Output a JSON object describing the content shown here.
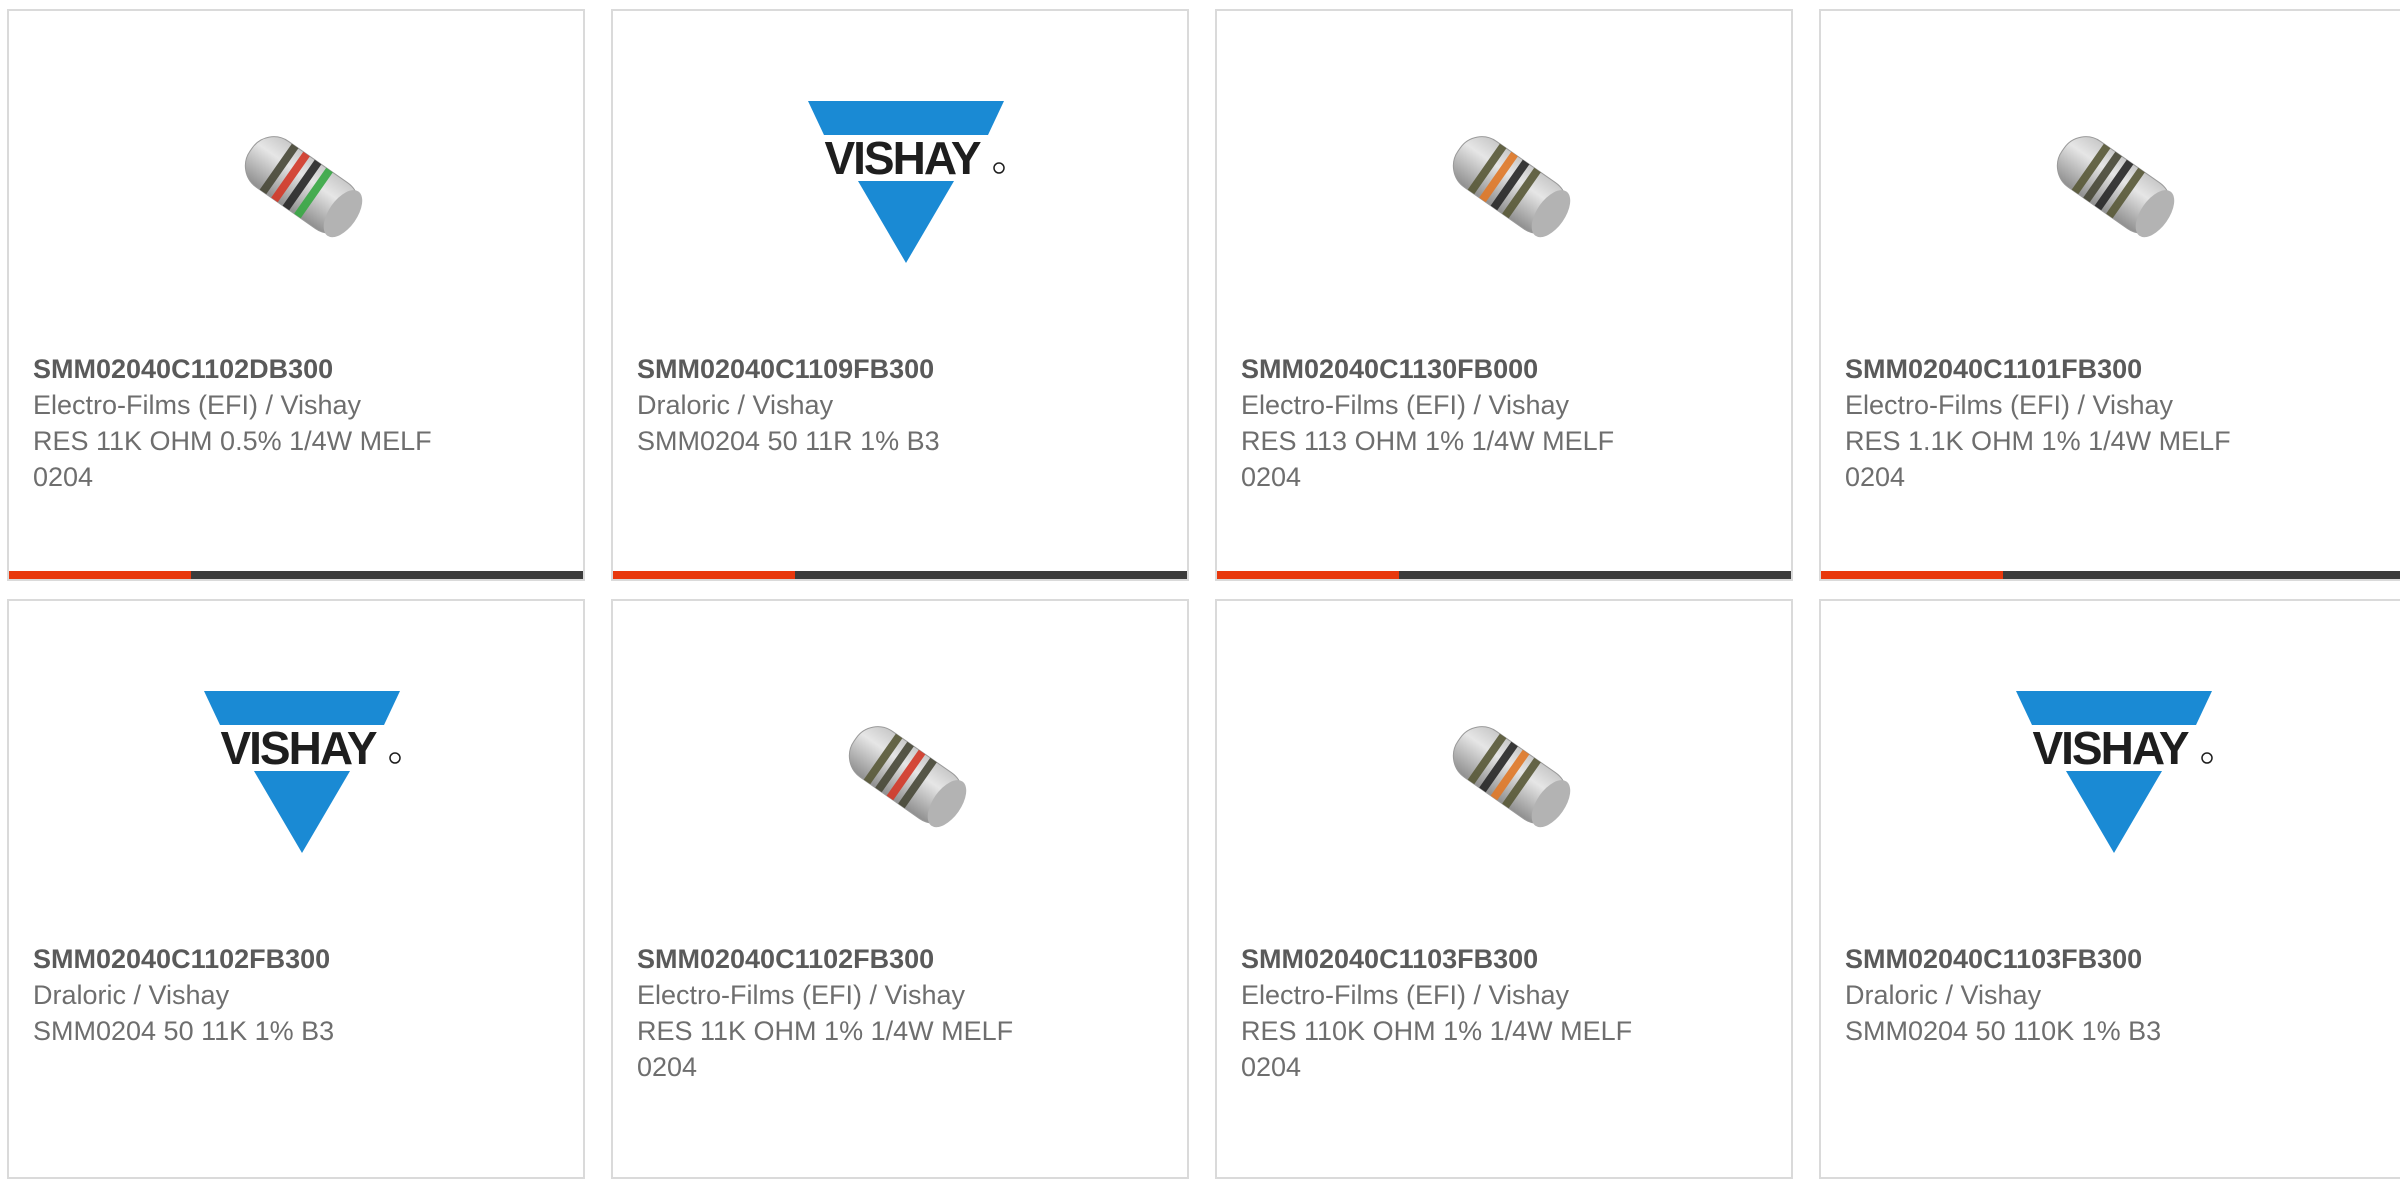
{
  "colors": {
    "accent": "#e8380d",
    "bar_dark": "#3b3b3b",
    "border": "#dadada",
    "text": "#666666",
    "vishay_blue": "#1a8ad4"
  },
  "brand_logo_text": "VISHAY",
  "products": [
    {
      "part_number": "SMM02040C1102DB300",
      "manufacturer": "Electro-Films (EFI) / Vishay",
      "description": "RES 11K OHM 0.5% 1/4W MELF 0204",
      "image": "resistor-icon",
      "bands": [
        "#4a4a3a",
        "#d33b2a",
        "#2a2a2a",
        "#3aa845"
      ]
    },
    {
      "part_number": "SMM02040C1109FB300",
      "manufacturer": "Draloric / Vishay",
      "description": "SMM0204 50 11R 1% B3",
      "image": "vishay-logo"
    },
    {
      "part_number": "SMM02040C1130FB000",
      "manufacturer": "Electro-Films (EFI) / Vishay",
      "description": "RES 113 OHM 1% 1/4W MELF 0204",
      "image": "resistor-icon",
      "bands": [
        "#5a5a3a",
        "#e07a2a",
        "#2a2a2a",
        "#5a5a3a"
      ]
    },
    {
      "part_number": "SMM02040C1101FB300",
      "manufacturer": "Electro-Films (EFI) / Vishay",
      "description": "RES 1.1K OHM 1% 1/4W MELF 0204",
      "image": "resistor-icon",
      "bands": [
        "#5a5a3a",
        "#4a4a3a",
        "#2a2a2a",
        "#5a5a3a"
      ]
    },
    {
      "part_number": "SMM02040C1102FB300",
      "manufacturer": "Draloric / Vishay",
      "description": "SMM0204 50 11K 1% B3",
      "image": "vishay-logo"
    },
    {
      "part_number": "SMM02040C1102FB300",
      "manufacturer": "Electro-Films (EFI) / Vishay",
      "description": "RES 11K OHM 1% 1/4W MELF 0204",
      "image": "resistor-icon",
      "bands": [
        "#5a5a3a",
        "#4a4a3a",
        "#d33b2a",
        "#4a4a3a"
      ]
    },
    {
      "part_number": "SMM02040C1103FB300",
      "manufacturer": "Electro-Films (EFI) / Vishay",
      "description": "RES 110K OHM 1% 1/4W MELF 0204",
      "image": "resistor-icon",
      "bands": [
        "#5a5a3a",
        "#2a2a2a",
        "#e07a2a",
        "#5a5a3a"
      ]
    },
    {
      "part_number": "SMM02040C1103FB300",
      "manufacturer": "Draloric / Vishay",
      "description": "SMM0204 50 110K 1% B3",
      "image": "vishay-logo"
    }
  ]
}
